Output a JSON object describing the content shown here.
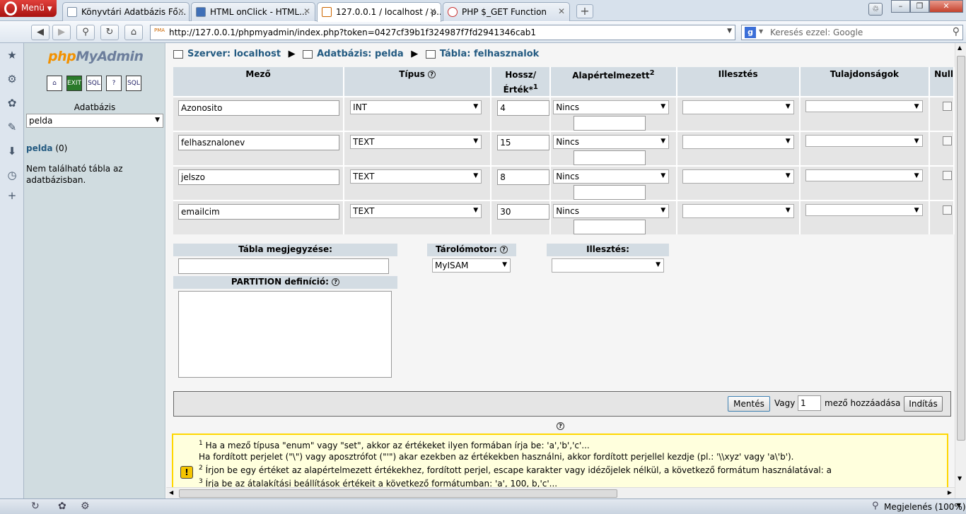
{
  "browser": {
    "menu_label": "Menü",
    "tabs": [
      {
        "title": "Könyvtári Adatbázis Fő..."
      },
      {
        "title": "HTML onClick - HTML..."
      },
      {
        "title": "127.0.0.1 / localhost / p..."
      },
      {
        "title": "PHP $_GET Function"
      }
    ],
    "url": "http://127.0.0.1/phpmyadmin/index.php?token=0427cf39b1f324987f7fd2941346cab1",
    "search_placeholder": "Keresés ezzel: Google",
    "zoom": "Megjelenés (100%)"
  },
  "left": {
    "logo_a": "php",
    "logo_b": "MyAdmin",
    "db_label": "Adatbázis",
    "db_selected": "pelda",
    "db_link": "pelda",
    "db_count": "(0)",
    "no_tables": "Nem található tábla az adatbázisban."
  },
  "breadcrumb": {
    "server": "Szerver: localhost",
    "database": "Adatbázis: pelda",
    "table": "Tábla: felhasznalok"
  },
  "columns": {
    "field": "Mező",
    "type": "Típus",
    "length_a": "Hossz/",
    "length_b": "Érték*",
    "length_sup": "1",
    "default": "Alapértelmezett",
    "default_sup": "2",
    "collation": "Illesztés",
    "attributes": "Tulajdonságok",
    "null": "Null"
  },
  "rows": [
    {
      "name": "Azonosito",
      "type": "INT",
      "length": "4",
      "default": "Nincs"
    },
    {
      "name": "felhasznalonev",
      "type": "TEXT",
      "length": "15",
      "default": "Nincs"
    },
    {
      "name": "jelszo",
      "type": "TEXT",
      "length": "8",
      "default": "Nincs"
    },
    {
      "name": "emailcim",
      "type": "TEXT",
      "length": "30",
      "default": "Nincs"
    }
  ],
  "options": {
    "comment_label": "Tábla megjegyzése:",
    "engine_label": "Tárolómotor:",
    "engine_value": "MyISAM",
    "collation_label": "Illesztés:",
    "partition_label": "PARTITION definíció:"
  },
  "actions": {
    "save": "Mentés",
    "or": "Vagy",
    "add_count": "1",
    "add_fields": "mező hozzáadása",
    "go": "Indítás"
  },
  "notes": {
    "n1_sup": "1",
    "n1": "Ha a mező típusa \"enum\" vagy \"set\", akkor az értékeket ilyen formában írja be: 'a','b','c'...",
    "n1b": "Ha fordított perjelet (\"\\\") vagy aposztrófot (\"'\") akar ezekben az értékekben használni, akkor fordított perjellel kezdje (pl.: '\\\\xyz' vagy 'a\\'b').",
    "n2_sup": "2",
    "n2": "Írjon be egy értéket az alapértelmezett értékekhez, fordított perjel, escape karakter vagy idézőjelek nélkül, a következő formátum használatával: a",
    "n3_sup": "3",
    "n3": "Írja be az átalakítási beállítások értékeit a következő formátumban: 'a', 100, b,'c'..."
  }
}
